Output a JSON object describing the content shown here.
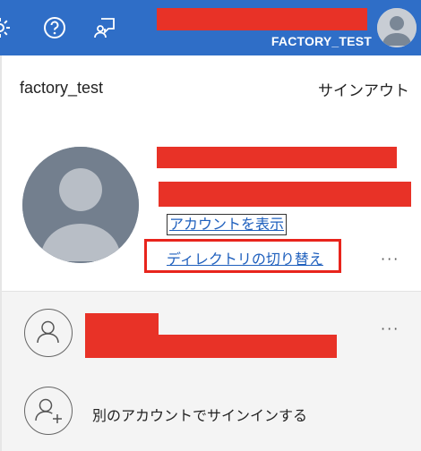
{
  "header": {
    "user_name": "FACTORY_TEST",
    "icons": [
      "settings-icon",
      "help-icon",
      "feedback-icon"
    ],
    "bar_color": "#2f6ec7"
  },
  "account_panel": {
    "tenant_name": "factory_test",
    "sign_out_label": "サインアウト",
    "view_account_label": "アカウントを表示",
    "switch_directory_label": "ディレクトリの切り替え",
    "more_options_label": "···",
    "highlight_color": "#e8241c",
    "link_color": "#1e5fbd"
  },
  "other_accounts": {
    "more_options_label": "···",
    "add_account_label": "別のアカウントでサインインする"
  },
  "redaction_color": "#e83227"
}
